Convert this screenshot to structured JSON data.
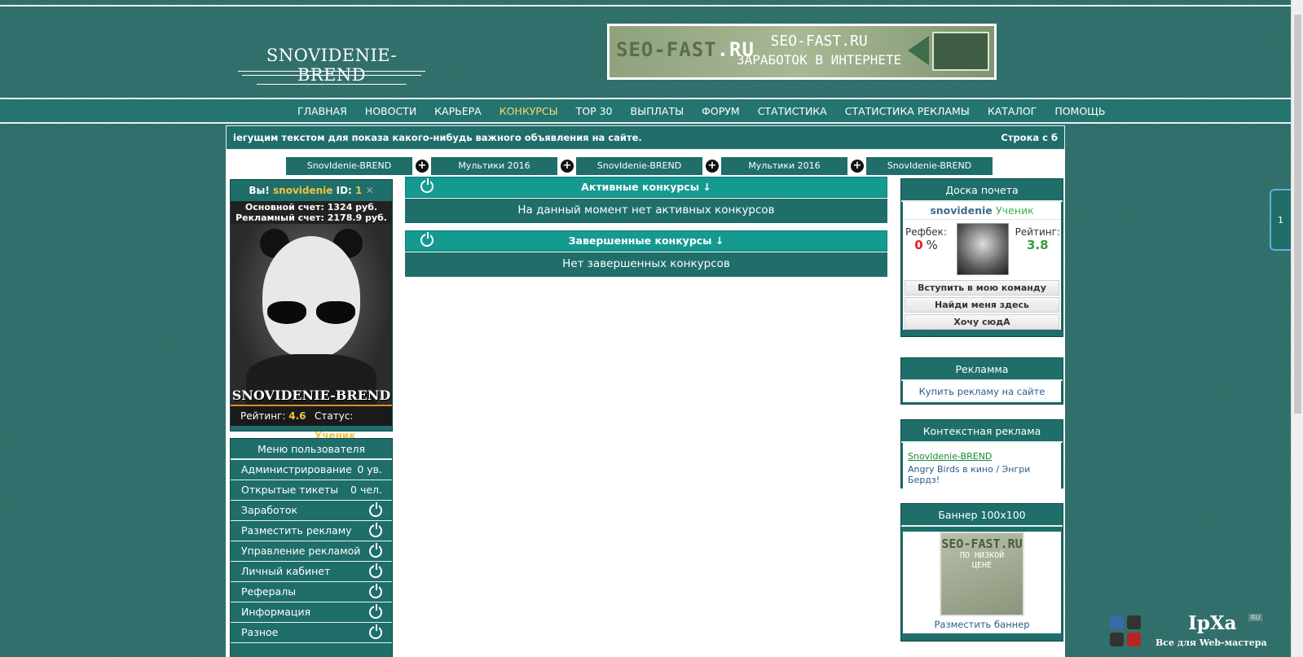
{
  "site": {
    "logo_text": "SNOVIDENIE-BREND"
  },
  "top_banner": {
    "left_text": "SEO-FAST",
    "left_ru": ".RU",
    "line1": "SEO-FAST.RU",
    "line2": "ЗАРАБОТОК В ИНТЕРНЕТЕ"
  },
  "nav": {
    "items": [
      "ГЛАВНАЯ",
      "НОВОСТИ",
      "КАРЬЕРА",
      "КОНКУРСЫ",
      "TOP 30",
      "ВЫПЛАТЫ",
      "ФОРУМ",
      "СТАТИСТИКА",
      "СТАТИСТИКА РЕКЛАМЫ",
      "КАТАЛОГ",
      "ПОМОЩЬ"
    ],
    "active": "КОНКУРСЫ"
  },
  "ticker": {
    "text_left": "іегущим текстом для показа какого-нибудь важного объявления на сайте.",
    "text_right": "Строка с б"
  },
  "tabs": [
    "SnovIdenie-BREND",
    "Мультики 2016",
    "SnovIdenie-BREND",
    "Мультики 2016",
    "SnovIdenie-BREND"
  ],
  "profile": {
    "greeting": "Вы!",
    "username": "snovidenie",
    "id_label": "ID:",
    "id_value": "1",
    "close_glyph": "✕",
    "main_account": "Основной счет: 1324 руб.",
    "ad_account": "Рекламный счет: 2178.9 руб.",
    "photo_brand": "SNOVIDENIE-BREND",
    "rating_label": "Рейтинг:",
    "rating_value": "4.6",
    "status_label": "Статус:",
    "status_value": "Ученик"
  },
  "user_menu": {
    "title": "Меню пользователя",
    "items": [
      {
        "label": "Администрирование",
        "count": "0 ув."
      },
      {
        "label": "Открытые тикеты",
        "count": "0 чел."
      },
      {
        "label": "Заработок",
        "icon": "power-icon"
      },
      {
        "label": "Разместить рекламу",
        "icon": "power-icon"
      },
      {
        "label": "Управление рекламой",
        "icon": "power-icon"
      },
      {
        "label": "Личный кабинет",
        "icon": "power-icon"
      },
      {
        "label": "Рефералы",
        "icon": "power-icon"
      },
      {
        "label": "Информация",
        "icon": "power-icon"
      },
      {
        "label": "Разное",
        "icon": "power-icon"
      }
    ]
  },
  "contests": {
    "active_header": "Активные конкурсы ↓",
    "active_body": "На данный момент нет активных конкурсов",
    "finished_header": "Завершенные конкурсы ↓",
    "finished_body": "Нет завершенных конкурсов"
  },
  "honor_board": {
    "title": "Доска почета",
    "username": "snovidenie",
    "level": "Ученик",
    "refback_label": "Рефбек:",
    "refback_value": "0",
    "refback_unit": "%",
    "rating_label": "Рейтинг:",
    "rating_value": "3.8",
    "btn_join": "Вступить в мою команду",
    "btn_find": "Найди меня здесь",
    "btn_want": "Хочу сюдА"
  },
  "ads": {
    "title": "Рекламма",
    "link": "Купить рекламу на сайте"
  },
  "context_ads": {
    "title": "Контекстная реклама",
    "link": "SnovIdenie-BREND",
    "desc": "Angry Birds в кино / Энгри Бердз!"
  },
  "banner100": {
    "title": "Баннер 100x100",
    "img_title": "SEO-FAST.RU",
    "img_line1": "ПО НИЗКОЙ",
    "img_line2": "ЦЕНЕ",
    "link": "Разместить баннер"
  },
  "right_tab": {
    "label": "1"
  },
  "watermark": {
    "word": "IpXa",
    "ru": "RU",
    "sub": "Все для Web-мастера"
  },
  "colors": {
    "teal": "#1f6e69",
    "teal_bright": "#159a91",
    "gold": "#f3c340",
    "nav_active": "#f7d77a"
  }
}
